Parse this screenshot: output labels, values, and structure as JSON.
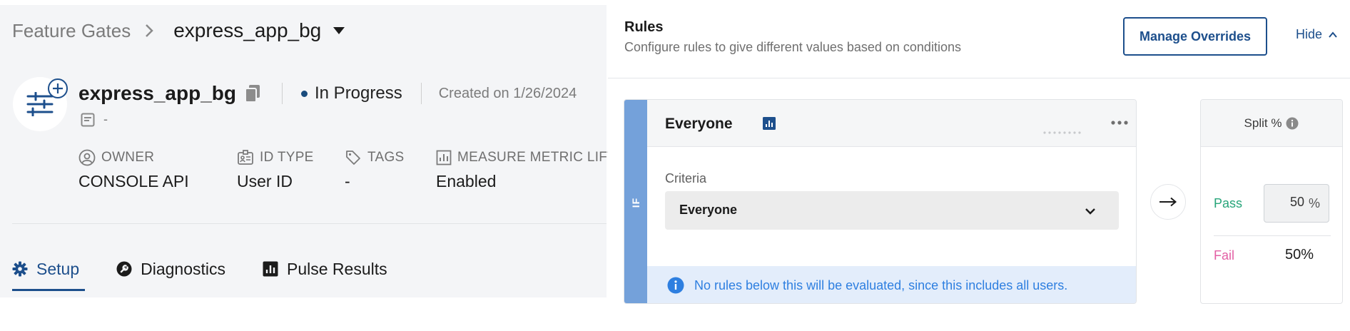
{
  "breadcrumb": {
    "parent": "Feature Gates",
    "current": "express_app_bg"
  },
  "gate": {
    "name": "express_app_bg",
    "status": "In Progress",
    "created": "Created on 1/26/2024",
    "description": "-"
  },
  "meta": [
    {
      "label": "OWNER",
      "value": "CONSOLE API",
      "icon": "user-circle-icon"
    },
    {
      "label": "ID TYPE",
      "value": "User ID",
      "icon": "id-badge-icon"
    },
    {
      "label": "TAGS",
      "value": "-",
      "icon": "tag-icon"
    },
    {
      "label": "MEASURE METRIC LIFTS",
      "value": "Enabled",
      "icon": "chart-icon"
    }
  ],
  "tabs": [
    {
      "label": "Setup",
      "icon": "gear-icon",
      "active": true
    },
    {
      "label": "Diagnostics",
      "icon": "wrench-icon",
      "active": false
    },
    {
      "label": "Pulse Results",
      "icon": "bar-chart-icon",
      "active": false
    }
  ],
  "rules": {
    "title": "Rules",
    "subtitle": "Configure rules to give different values based on conditions",
    "manage_overrides": "Manage Overrides",
    "hide": "Hide",
    "if_label": "IF",
    "rule": {
      "name": "Everyone",
      "criteria_label": "Criteria",
      "criteria_value": "Everyone",
      "info": "No rules below this will be evaluated, since this includes all users."
    },
    "split": {
      "title": "Split %",
      "pass_label": "Pass",
      "pass_value": "50",
      "pass_unit": "%",
      "fail_label": "Fail",
      "fail_value": "50%"
    }
  },
  "colors": {
    "accent": "#1d4f8c",
    "if_bar": "#74a1da",
    "pass": "#27a57a",
    "fail": "#e35fa4",
    "info": "#2e7fe0"
  }
}
